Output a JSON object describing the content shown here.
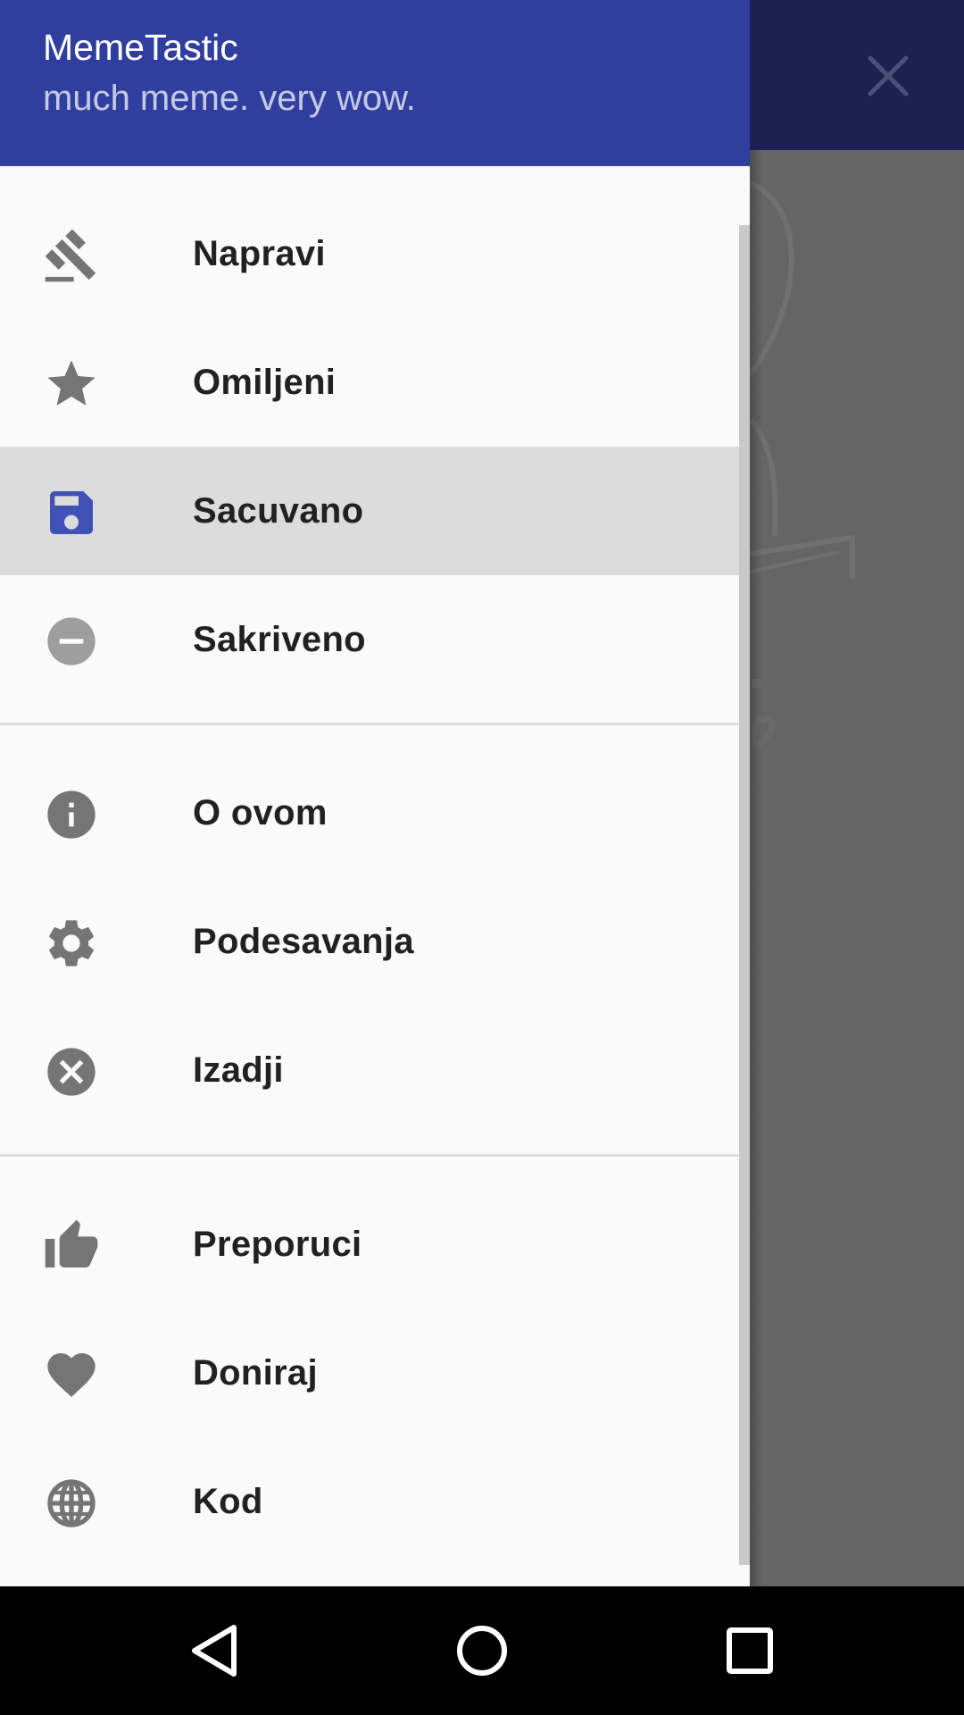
{
  "drawer": {
    "title": "MemeTastic",
    "subtitle": "much meme. very wow.",
    "groups": [
      [
        {
          "label": "Napravi",
          "icon": "gavel-icon"
        },
        {
          "label": "Omiljeni",
          "icon": "star-icon"
        },
        {
          "label": "Sacuvano",
          "icon": "save-icon",
          "selected": true
        },
        {
          "label": "Sakriveno",
          "icon": "remove-circle-icon"
        }
      ],
      [
        {
          "label": "O ovom",
          "icon": "info-icon"
        },
        {
          "label": "Podesavanja",
          "icon": "settings-gear-icon"
        },
        {
          "label": "Izadji",
          "icon": "cancel-icon"
        }
      ],
      [
        {
          "label": "Preporuci",
          "icon": "thumb-up-icon"
        },
        {
          "label": "Doniraj",
          "icon": "heart-icon"
        },
        {
          "label": "Kod",
          "icon": "globe-icon"
        }
      ]
    ]
  },
  "colors": {
    "primary": "#303f9f",
    "primary_dark_dimmed": "#1b2150",
    "selected_icon": "#3f51b5",
    "icon_gray": "#757575",
    "text_primary": "#212121",
    "selected_background": "#dcdcdc"
  },
  "navigation_bar": {
    "buttons": [
      "back-icon",
      "home-icon",
      "recents-icon"
    ]
  }
}
